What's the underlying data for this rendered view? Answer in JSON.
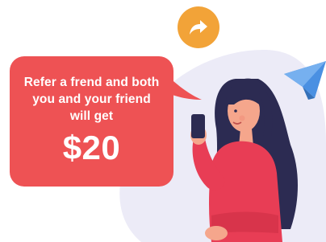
{
  "referral": {
    "message": "Refer a frend and both you and your friend will get",
    "amount": "$20"
  },
  "icons": {
    "share": "share-arrow-icon",
    "paper_plane": "paper-plane-icon"
  },
  "colors": {
    "bubble": "#ee5254",
    "share_button": "#f2a338",
    "background_blob": "#ecebf7",
    "paper_plane": "#4a90e2"
  }
}
